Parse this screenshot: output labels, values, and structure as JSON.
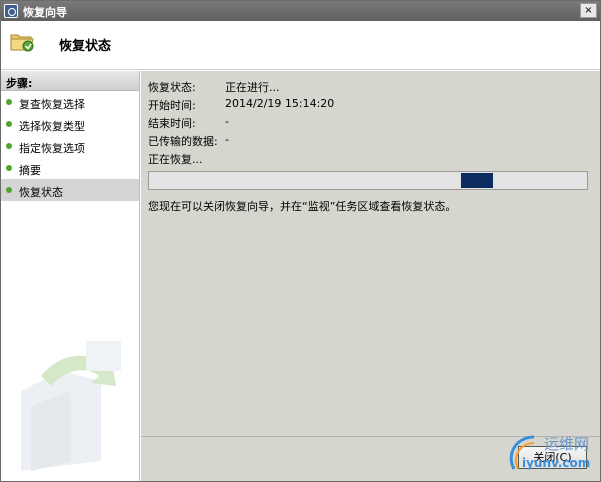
{
  "window": {
    "title": "恢复向导",
    "close_label": "×"
  },
  "header": {
    "title": "恢复状态",
    "icon": "folder-restore-icon"
  },
  "sidebar": {
    "heading": "步骤:",
    "items": [
      {
        "label": "复查恢复选择"
      },
      {
        "label": "选择恢复类型"
      },
      {
        "label": "指定恢复选项"
      },
      {
        "label": "摘要"
      },
      {
        "label": "恢复状态",
        "selected": true
      }
    ]
  },
  "status": {
    "fields": [
      {
        "label": "恢复状态:",
        "value": "正在进行..."
      },
      {
        "label": "开始时间:",
        "value": "2014/2/19 15:14:20"
      },
      {
        "label": "结束时间:",
        "value": "-"
      },
      {
        "label": "已传输的数据:",
        "value": "-"
      }
    ],
    "progress_label": "正在恢复...",
    "info": "您现在可以关闭恢复向导，并在“监视”任务区域查看恢复状态。"
  },
  "footer": {
    "close_button": "关闭(C)"
  },
  "watermark": {
    "cn": "运维网",
    "en": "iyunv.com"
  },
  "colors": {
    "titlebar": "#6b6b6b",
    "content_bg": "#d6d5ce",
    "progress_chunk": "#0c2b5e",
    "step_dot": "#4fa52a"
  }
}
